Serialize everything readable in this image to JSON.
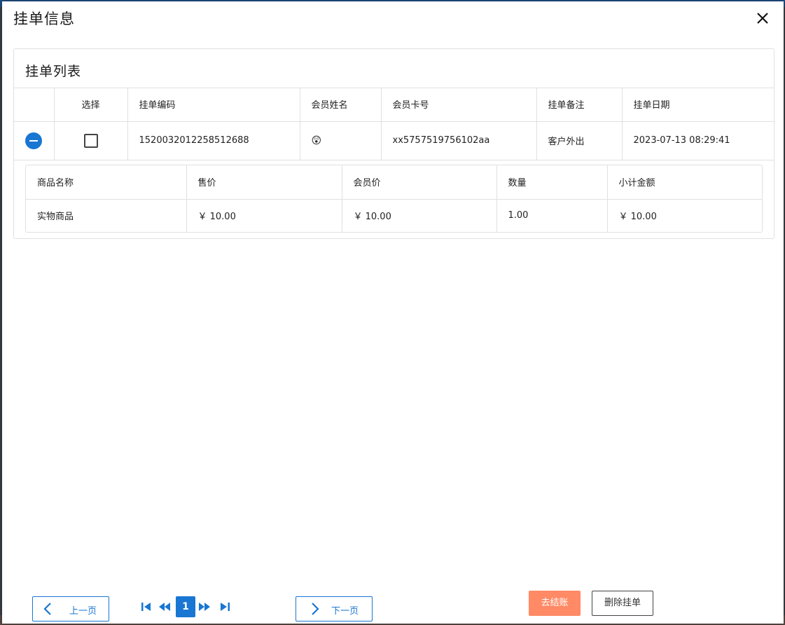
{
  "dialog": {
    "title": "挂单信息"
  },
  "card": {
    "title": "挂单列表"
  },
  "list": {
    "columns": [
      "",
      "选择",
      "挂单编码",
      "会员姓名",
      "会员卡号",
      "挂单备注",
      "挂单日期"
    ],
    "rows": [
      {
        "code": "1520032012258512688",
        "member_name": "😲",
        "card_no": "xx5757519756102aa",
        "note": "客户外出",
        "date": "2023-07-13 08:29:41"
      }
    ]
  },
  "detail": {
    "columns": [
      "商品名称",
      "售价",
      "会员价",
      "数量",
      "小计金额"
    ],
    "rows": [
      {
        "name": "实物商品",
        "price": "￥ 10.00",
        "member_price": "￥ 10.00",
        "qty": "1.00",
        "subtotal": "￥ 10.00"
      }
    ]
  },
  "pager": {
    "prev_label": "上一页",
    "next_label": "下一页",
    "current_page": "1"
  },
  "actions": {
    "checkout_label": "去结账",
    "delete_label": "删除挂单"
  },
  "colors": {
    "primary": "#1976d2",
    "checkout": "#ff8a65",
    "border": "#e0e0e0"
  }
}
